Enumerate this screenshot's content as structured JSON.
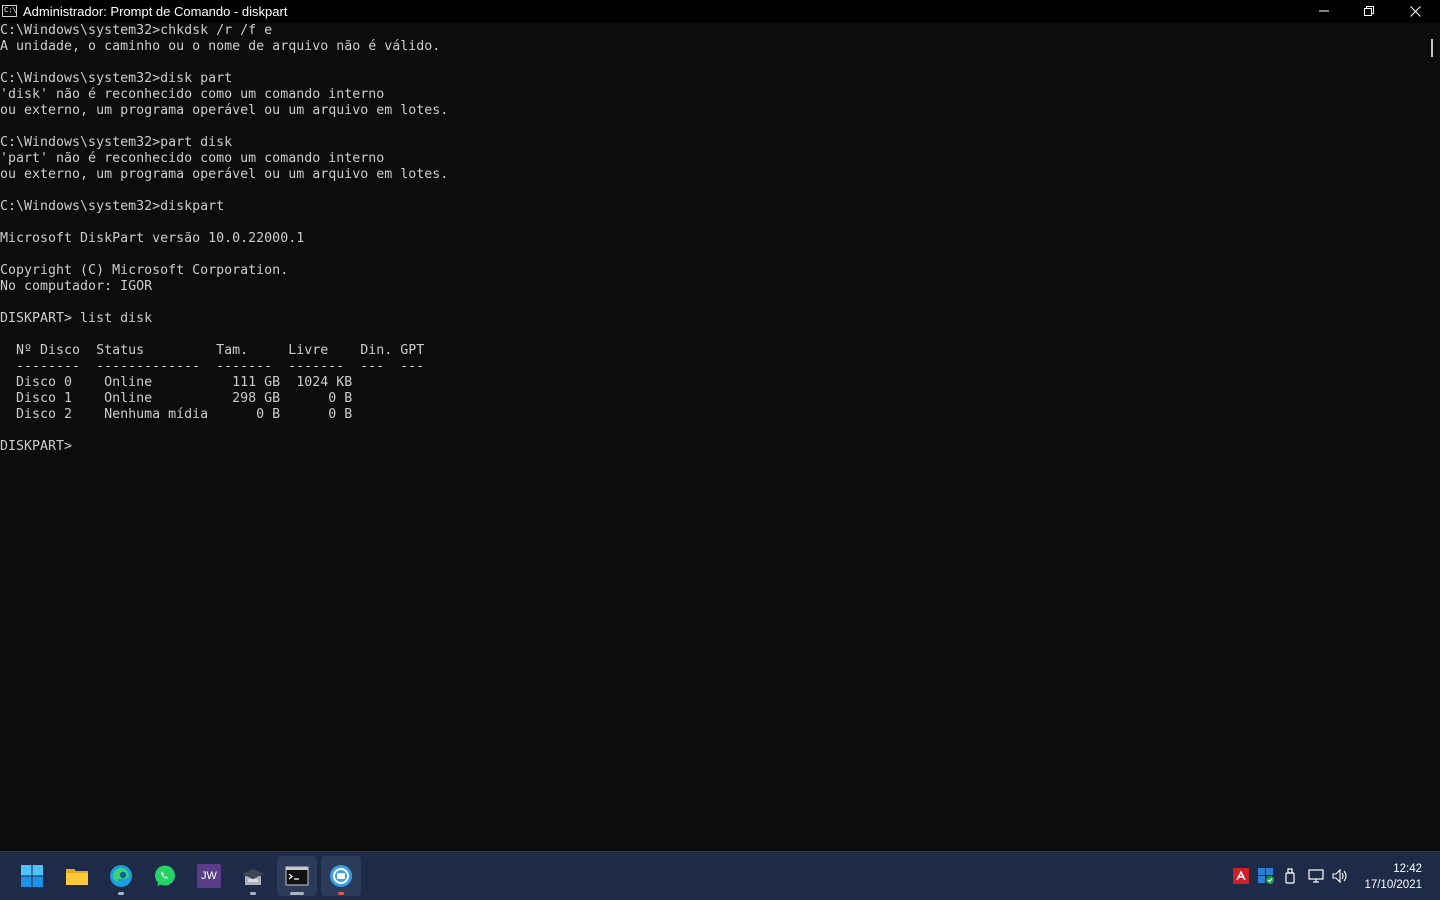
{
  "window": {
    "title": "Administrador: Prompt de Comando - diskpart",
    "icon_label": "C:\\"
  },
  "console": {
    "lines": [
      "C:\\Windows\\system32>chkdsk /r /f e",
      "A unidade, o caminho ou o nome de arquivo não é válido.",
      "",
      "C:\\Windows\\system32>disk part",
      "'disk' não é reconhecido como um comando interno",
      "ou externo, um programa operável ou um arquivo em lotes.",
      "",
      "C:\\Windows\\system32>part disk",
      "'part' não é reconhecido como um comando interno",
      "ou externo, um programa operável ou um arquivo em lotes.",
      "",
      "C:\\Windows\\system32>diskpart",
      "",
      "Microsoft DiskPart versão 10.0.22000.1",
      "",
      "Copyright (C) Microsoft Corporation.",
      "No computador: IGOR",
      "",
      "DISKPART> list disk",
      "",
      "  Nº Disco  Status         Tam.     Livre    Din. GPT",
      "  --------  -------------  -------  -------  ---  ---",
      "  Disco 0    Online          111 GB  1024 KB",
      "  Disco 1    Online          298 GB      0 B",
      "  Disco 2    Nenhuma mídia      0 B      0 B",
      "",
      "DISKPART> "
    ]
  },
  "taskbar": {
    "items": [
      {
        "name": "start-button-icon"
      },
      {
        "name": "file-explorer-icon"
      },
      {
        "name": "edge-browser-icon"
      },
      {
        "name": "whatsapp-icon"
      },
      {
        "name": "jw-library-icon",
        "label": "JW"
      },
      {
        "name": "graduation-cap-app-icon"
      },
      {
        "name": "command-prompt-icon"
      },
      {
        "name": "blue-circular-app-icon"
      }
    ],
    "tray": {
      "icons": [
        "amd-radeon-icon",
        "windows-security-icon",
        "usb-device-icon",
        "network-icon",
        "volume-icon"
      ]
    },
    "clock": {
      "time": "12:42",
      "date": "17/10/2021"
    }
  },
  "colors": {
    "console_bg": "#0c0c0c",
    "console_text": "#cccccc",
    "taskbar_bg": "#1d2b48",
    "accent": "#0078d4"
  }
}
